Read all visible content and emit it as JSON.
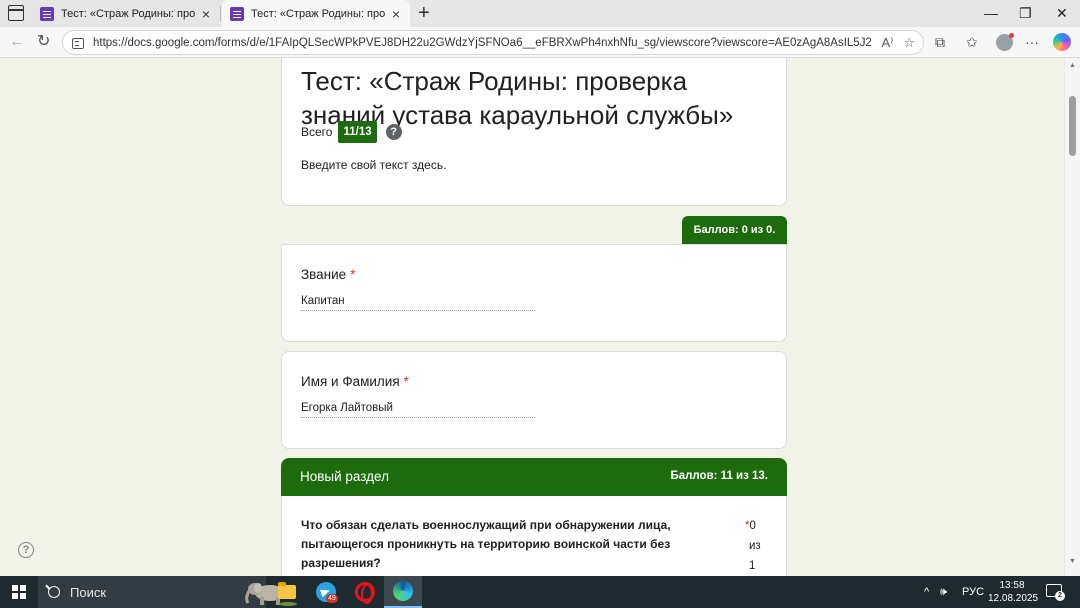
{
  "browser": {
    "tabs": [
      {
        "title": "Тест: «Страж Родины: проверка",
        "active": false
      },
      {
        "title": "Тест: «Страж Родины: проверка",
        "active": true
      }
    ],
    "url": "https://docs.google.com/forms/d/e/1FAIpQLSecWPkPVEJ8DH22u2GWdzYjSFNOa6__eFBRXwPh4nxhNfu_sg/viewscore?viewscore=AE0zAgA8AsIL5J2H_jtnaDEL...",
    "icons": {
      "tab_actions": "tab-actions-icon",
      "new_tab": "+",
      "close_tab": "×",
      "minimize": "—",
      "maximize": "❐",
      "close_window": "✕",
      "back": "←",
      "refresh": "↻",
      "read_aloud": "A⁾",
      "favorite": "☆",
      "extensions": "⧉",
      "favorites": "✩",
      "more": "···"
    }
  },
  "form": {
    "title": "Тест: «Страж Родины: проверка знаний устава караульной службы»",
    "total_label": "Всего",
    "total_score": "11/13",
    "help_glyph": "?",
    "description": "Введите свой текст здесь.",
    "points_tab": "Баллов: 0 из 0.",
    "questions": [
      {
        "label": "Звание",
        "required": "*",
        "answer": "Капитан"
      },
      {
        "label": "Имя и Фамилия",
        "required": "*",
        "answer": "Егорка Лайтовый"
      }
    ],
    "section": {
      "title": "Новый раздел",
      "score": "Баллов: 11 из 13."
    },
    "question3": {
      "text": "Что обязан сделать военнослужащий при обнаружении лица, пытающегося проникнуть на территорию воинской части без разрешения?",
      "required": "*",
      "points_got": "0",
      "points_of": "из",
      "points_max": "1"
    }
  },
  "page_help_glyph": "?",
  "taskbar": {
    "search_label": "Поиск",
    "telegram_badge": "49",
    "tray_chevron": "^",
    "volume": "🕪",
    "language": "РУС",
    "time": "13:58",
    "date": "12.08.2025",
    "notifications": "2"
  },
  "colors": {
    "accent_green": "#1e6b0e",
    "page_background": "#f1f3e8",
    "required_red": "#d93025"
  }
}
